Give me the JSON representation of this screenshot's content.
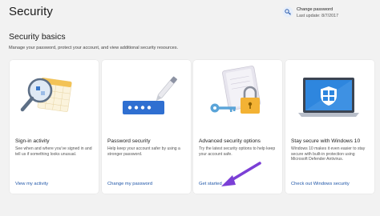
{
  "header": {
    "title": "Security",
    "password_link": "Change password",
    "password_last_update": "Last update: 8/7/2017"
  },
  "basics": {
    "title": "Security basics",
    "description": "Manage your password, protect your account, and view additional security resources."
  },
  "cards": [
    {
      "title": "Sign-in activity",
      "description": "See when and where you've signed in and tell us if something looks unusual.",
      "link": "View my activity",
      "icon": "magnifier-calendar-icon"
    },
    {
      "title": "Password security",
      "description": "Help keep your account safer by using a stronger password.",
      "link": "Change my password",
      "icon": "password-pen-icon"
    },
    {
      "title": "Advanced security options",
      "description": "Try the latest security options to help keep your account safe.",
      "link": "Get started",
      "icon": "key-lock-book-icon"
    },
    {
      "title": "Stay secure with Windows 10",
      "description": "Windows 10 makes it even easier to stay secure with built-in protection using Microsoft Defender Antivirus.",
      "link": "Check out Windows security",
      "icon": "laptop-shield-icon"
    }
  ],
  "colors": {
    "background": "#f2f2f2",
    "link": "#1f56a8",
    "annotation_arrow": "#7b3fd6"
  }
}
